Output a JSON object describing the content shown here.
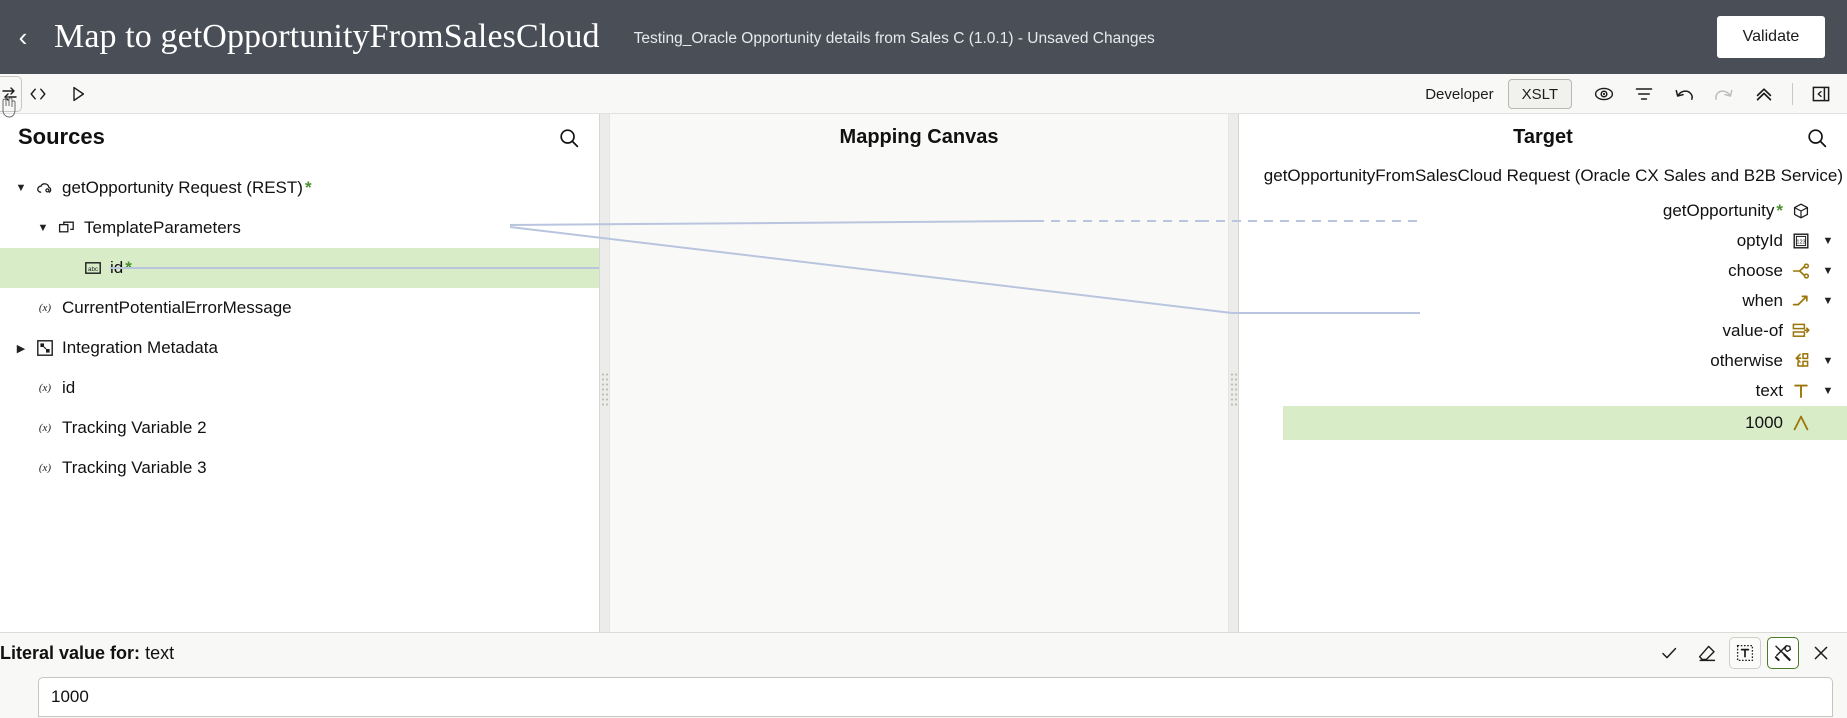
{
  "header": {
    "back_icon": "chevron-left-icon",
    "title": "Map to getOpportunityFromSalesCloud",
    "subtitle": "Testing_Oracle Opportunity details from Sales C (1.0.1) - Unsaved Changes",
    "validate_label": "Validate"
  },
  "toolbar": {
    "code_icon": "code-brackets-icon",
    "run_icon": "play-icon",
    "developer_label": "Developer",
    "xslt_label": "XSLT",
    "view_icon": "eye-icon",
    "filter_icon": "filter-icon",
    "undo_icon": "undo-icon",
    "redo_icon": "redo-icon",
    "collapse_icon": "chevron-double-up-icon",
    "panel_toggle_icon": "panel-collapse-icon",
    "ghost_icon": "swap-arrows-icon"
  },
  "sources": {
    "title": "Sources",
    "search_icon": "search-icon",
    "items": [
      {
        "label": "getOpportunity Request (REST)",
        "required": true,
        "icon": "cloud-icon",
        "indent": 0,
        "twisty": "open",
        "highlight": false
      },
      {
        "label": "TemplateParameters",
        "required": false,
        "icon": "struct-icon",
        "indent": 1,
        "twisty": "open",
        "highlight": false
      },
      {
        "label": "id",
        "required": true,
        "icon": "abc-icon",
        "indent": 2,
        "twisty": "none",
        "highlight": true
      },
      {
        "label": "CurrentPotentialErrorMessage",
        "required": false,
        "icon": "variable-icon",
        "indent": 0,
        "twisty": "none",
        "highlight": false
      },
      {
        "label": "Integration Metadata",
        "required": false,
        "icon": "metadata-icon",
        "indent": 0,
        "twisty": "closed",
        "highlight": false
      },
      {
        "label": "id",
        "required": false,
        "icon": "variable-icon",
        "indent": 0,
        "twisty": "none",
        "highlight": false
      },
      {
        "label": "Tracking Variable 2",
        "required": false,
        "icon": "variable-icon",
        "indent": 0,
        "twisty": "none",
        "highlight": false
      },
      {
        "label": "Tracking Variable 3",
        "required": false,
        "icon": "variable-icon",
        "indent": 0,
        "twisty": "none",
        "highlight": false
      }
    ]
  },
  "canvas": {
    "title": "Mapping Canvas"
  },
  "target": {
    "title": "Target",
    "search_icon": "search-icon",
    "root_label": "getOpportunityFromSalesCloud Request (Oracle CX Sales and B2B Service)",
    "items": [
      {
        "label": "getOpportunity",
        "required": true,
        "icon": "node-icon",
        "caret": false,
        "highlight": false
      },
      {
        "label": "optyId",
        "required": false,
        "icon": "number-icon",
        "caret": true,
        "highlight": false
      },
      {
        "label": "choose",
        "required": false,
        "icon": "choose-icon",
        "caret": true,
        "highlight": false
      },
      {
        "label": "when",
        "required": false,
        "icon": "when-icon",
        "caret": true,
        "highlight": false
      },
      {
        "label": "value-of",
        "required": false,
        "icon": "value-of-icon",
        "caret": false,
        "highlight": false
      },
      {
        "label": "otherwise",
        "required": false,
        "icon": "otherwise-icon",
        "caret": true,
        "highlight": false
      },
      {
        "label": "text",
        "required": false,
        "icon": "text-t-icon",
        "caret": true,
        "highlight": false
      },
      {
        "label": "1000",
        "required": false,
        "icon": "literal-a-icon",
        "caret": false,
        "highlight": true
      }
    ]
  },
  "literal_panel": {
    "label_prefix": "Literal value for:",
    "label_target": "text",
    "value": "1000",
    "accept_icon": "check-icon",
    "clear_icon": "eraser-icon",
    "text_mode_icon": "text-box-icon",
    "tools_icon": "tools-icon",
    "close_icon": "close-icon"
  },
  "colors": {
    "header_bg": "#4a4e57",
    "highlight_green": "#d8ecc8",
    "wire_blue": "#b9c5de",
    "gold_icon": "#9a7508",
    "required_green": "#4a8f2d",
    "active_border": "#4a7a23"
  }
}
